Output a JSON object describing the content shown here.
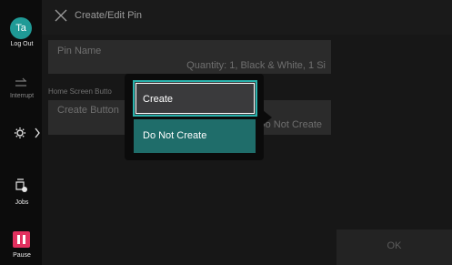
{
  "sidebar": {
    "avatar_initials": "Ta",
    "logout_label": "Log Out",
    "interrupt_label": "Interrupt",
    "jobs_label": "Jobs",
    "pause_label": "Pause"
  },
  "header": {
    "title": "Create/Edit Pin"
  },
  "form": {
    "pin_name_label": "Pin Name",
    "pin_name_value": "Quantity: 1, Black & White, 1 Si",
    "home_button_section": "Home Screen Butto",
    "create_button_label": "Create Button",
    "create_button_value": "Do Not Create"
  },
  "popup": {
    "option_create": "Create",
    "option_do_not_create": "Do Not Create"
  },
  "footer": {
    "ok_label": "OK"
  },
  "colors": {
    "accent": "#2ab3ad",
    "selected_bg": "#1f6d6a",
    "pause": "#e2315f"
  }
}
